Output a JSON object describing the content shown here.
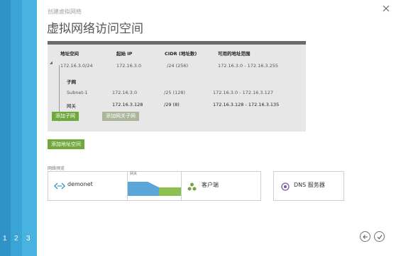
{
  "wizard": {
    "subtitle": "创建虚拟网络",
    "title": "虚拟网络访问空间",
    "steps": [
      "1",
      "2",
      "3"
    ]
  },
  "address_space": {
    "columns": [
      "地址空间",
      "起始 IP",
      "CIDR (地址数)",
      "可用的地址范围"
    ],
    "row": {
      "address": "172.16.3.0/24",
      "start_ip": "172.16.3.0",
      "cidr": "/24 (256)",
      "range": "172.16.3.0 - 172.16.3.255"
    },
    "subnets_label": "子网",
    "subnets": [
      {
        "name": "Subnet-1",
        "start_ip": "172.16.3.0",
        "cidr": "/25 (128)",
        "range": "172.16.3.0 - 172.16.3.127"
      },
      {
        "name": "网关",
        "start_ip": "172.16.3.128",
        "cidr": "/29 (8)",
        "range": "172.16.3.128 - 172.16.3.135"
      }
    ],
    "add_subnet_label": "添加子网",
    "add_gateway_subnet_label": "添加网关子网"
  },
  "add_address_space_label": "添加地址空间",
  "network_preview": {
    "label": "网络预览",
    "network_name": "demonet",
    "gateway_label": "网关",
    "clients_label": "客户端",
    "dns_label": "DNS 服务器"
  },
  "colors": {
    "accent_blue": "#3aa4d6",
    "button_green": "#70a83b",
    "gateway_blue": "#5aa6d8",
    "gateway_green": "#8cc152"
  }
}
